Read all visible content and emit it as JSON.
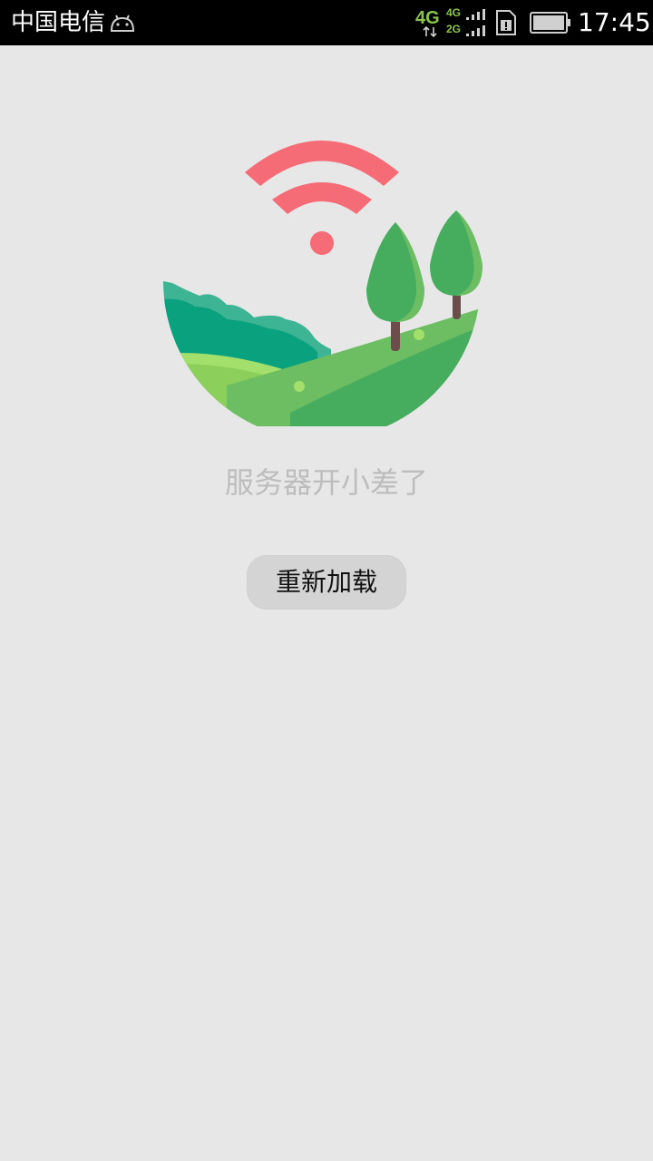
{
  "status_bar": {
    "carrier": "中国电信",
    "network_type": "4G",
    "network_sub": [
      "4G",
      "2G"
    ],
    "time": "17:45",
    "icons": [
      "android-icon",
      "network-4g-icon",
      "signal-icon",
      "sim-alert-icon",
      "battery-icon"
    ]
  },
  "main": {
    "illustration_icon": "no-connection-landscape-icon",
    "message": "服务器开小差了",
    "reload_label": "重新加载"
  },
  "colors": {
    "background": "#e7e7e7",
    "wifi": "#f56b76",
    "hill": "#6dbd63",
    "tree": "#46ad5f",
    "teal": "#0aa17e",
    "message": "#bdbdbd",
    "button": "#d4d4d4"
  }
}
